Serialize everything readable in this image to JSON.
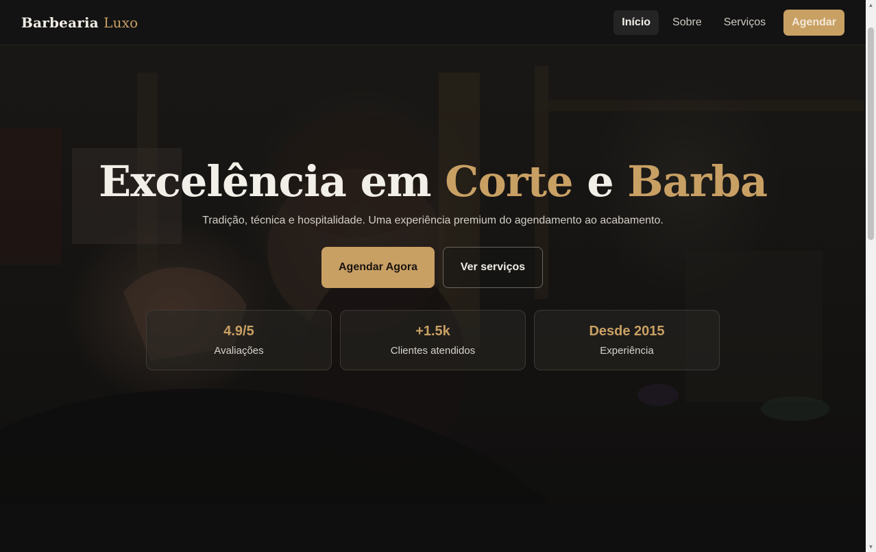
{
  "brand": {
    "word1": "Barbearia",
    "word2": "Luxo"
  },
  "nav": {
    "links": [
      "Início",
      "Sobre",
      "Serviços"
    ],
    "cta": "Agendar"
  },
  "hero": {
    "headline": {
      "part1": "Excelência em ",
      "gold1": "Corte",
      "part2": " e ",
      "gold2": "Barba"
    },
    "subtitle": "Tradição, técnica e hospitalidade. Uma experiência premium do agendamento ao acabamento.",
    "primary_button": "Agendar Agora",
    "secondary_button": "Ver serviços",
    "stats": [
      {
        "value": "4.9/5",
        "label": "Avaliações"
      },
      {
        "value": "+1.5k",
        "label": "Clientes atendidos"
      },
      {
        "value": "Desde 2015",
        "label": "Experiência"
      }
    ]
  },
  "colors": {
    "accent": "#c9a064",
    "background": "#0f0f0f",
    "header": "#131313"
  },
  "icons": {
    "scroll_up": "scroll-up-arrow-icon",
    "scroll_down": "scroll-down-arrow-icon"
  }
}
